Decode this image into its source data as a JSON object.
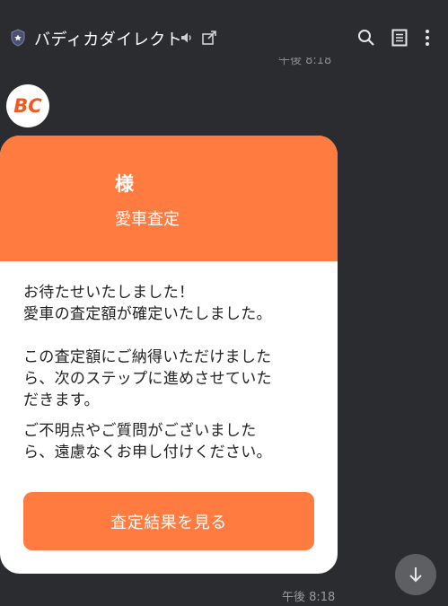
{
  "header": {
    "title": "バディカダイレクト",
    "icons": [
      "shield-icon",
      "speaker-icon",
      "external-link-icon",
      "search-icon",
      "notes-icon",
      "more-vertical-icon"
    ]
  },
  "previous_message": {
    "time": "午後 8:18"
  },
  "avatar": {
    "logo_text": "BC"
  },
  "card": {
    "honorific": "様",
    "subtitle": "愛車査定",
    "lines_1": [
      "お待たせいたしました！",
      "愛車の査定額が確定いたしました。"
    ],
    "lines_2": [
      "この査定額にご納得いただけました",
      "ら、次のステップに進めさせていた",
      "だきます。"
    ],
    "lines_3": [
      "ご不明点やご質問がございました",
      "ら、遠慮なくお申し付けください。"
    ],
    "button_label": "査定結果を見る"
  },
  "message_time": "午後 8:18",
  "colors": {
    "background": "#2b2c2f",
    "accent": "#ff7b3f",
    "card": "#ffffff"
  }
}
